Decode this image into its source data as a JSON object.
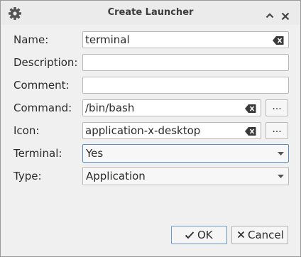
{
  "window": {
    "title": "Create Launcher"
  },
  "form": {
    "name": {
      "label": "Name:",
      "value": "terminal"
    },
    "description": {
      "label": "Description:",
      "value": ""
    },
    "comment": {
      "label": "Comment:",
      "value": ""
    },
    "command": {
      "label": "Command:",
      "value": "/bin/bash",
      "browse_label": "..."
    },
    "icon": {
      "label": "Icon:",
      "value": "application-x-desktop",
      "browse_label": "..."
    },
    "terminal": {
      "label": "Terminal:",
      "selected": "Yes"
    },
    "type": {
      "label": "Type:",
      "selected": "Application"
    }
  },
  "buttons": {
    "ok": "OK",
    "cancel": "Cancel"
  },
  "colors": {
    "focus_border": "#5a8ec0",
    "text": "#2b2b2b",
    "window_bg": "#f0f0f0"
  }
}
